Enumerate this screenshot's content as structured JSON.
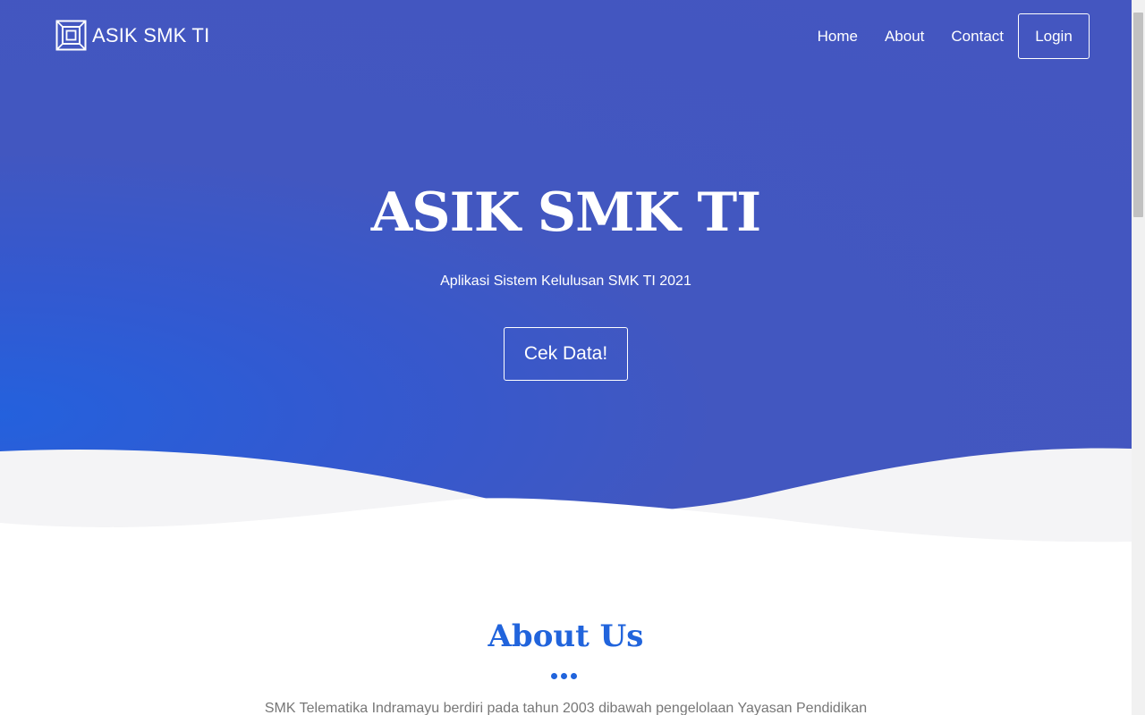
{
  "nav": {
    "brand": "ASIK SMK TI",
    "links": [
      "Home",
      "About",
      "Contact"
    ],
    "login": "Login"
  },
  "hero": {
    "title": "ASIK SMK TI",
    "subtitle": "Aplikasi Sistem Kelulusan SMK TI 2021",
    "cta": "Cek Data!"
  },
  "about": {
    "title": "About Us",
    "text": "SMK Telematika Indramayu berdiri pada tahun 2003 dibawah pengelolaan Yayasan Pendidikan"
  },
  "colors": {
    "hero_bg": "#4456c0",
    "hero_accent": "#2461dd",
    "wave_light": "#f4f4f6",
    "about_blue": "#2164dc"
  },
  "icons": {
    "brand_logo": "layers-logo-icon"
  }
}
